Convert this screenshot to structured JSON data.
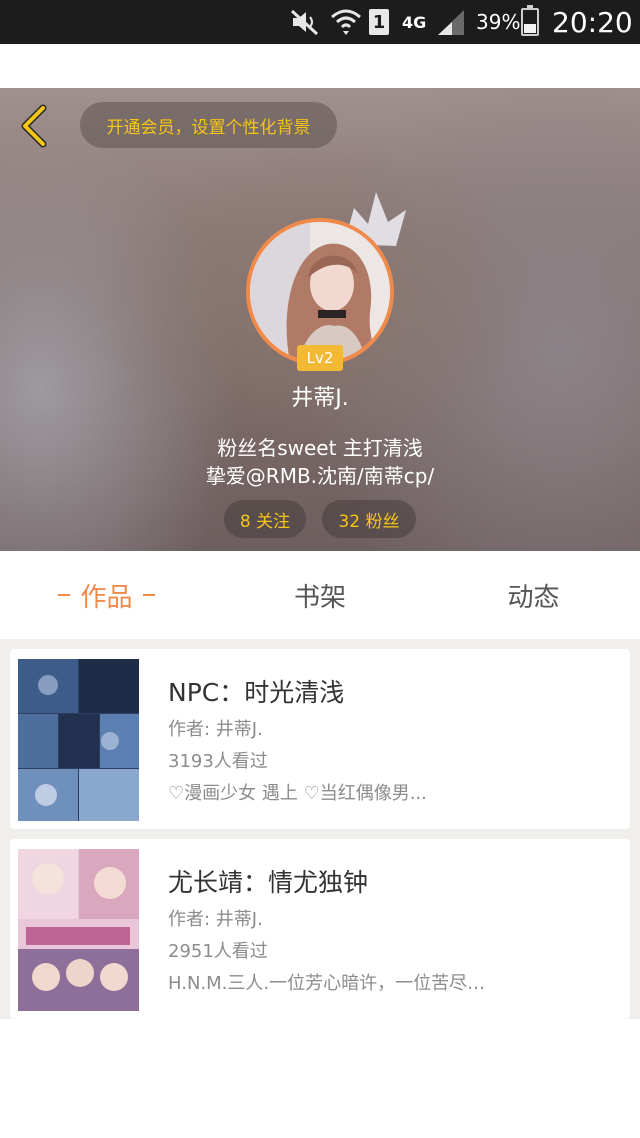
{
  "status_bar": {
    "network": "4G",
    "sim": "1",
    "battery_percent": "39%",
    "time": "20:20",
    "icons": [
      "mute-icon",
      "wifi-icon",
      "sim-icon",
      "signal-icon",
      "battery-icon"
    ]
  },
  "header": {
    "back_icon": "chevron-left-icon",
    "vip_prompt": "开通会员，设置个性化背景",
    "level": "Lv2",
    "username": "井蒂J.",
    "bio_line1": "粉丝名sweet  主打清浅",
    "bio_line2": "挚爱@RMB.沈南/南蒂cp/",
    "follow_label": "8 关注",
    "fans_label": "32 粉丝"
  },
  "tabs": {
    "works": "作品",
    "shelf": "书架",
    "feed": "动态",
    "active": "works"
  },
  "books": [
    {
      "title": "NPC：时光清浅",
      "author": "作者: 井蒂J.",
      "views": "3193人看过",
      "desc": "♡漫画少女 遇上 ♡当红偶像男..."
    },
    {
      "title": "尤长靖：情尤独钟",
      "author": "作者: 井蒂J.",
      "views": "2951人看过",
      "desc": "H.N.M.三人.一位芳心暗许，一位苦尽…"
    }
  ],
  "colors": {
    "accent": "#f08a4b",
    "gold": "#f5c518",
    "level_badge": "#f2b935"
  }
}
